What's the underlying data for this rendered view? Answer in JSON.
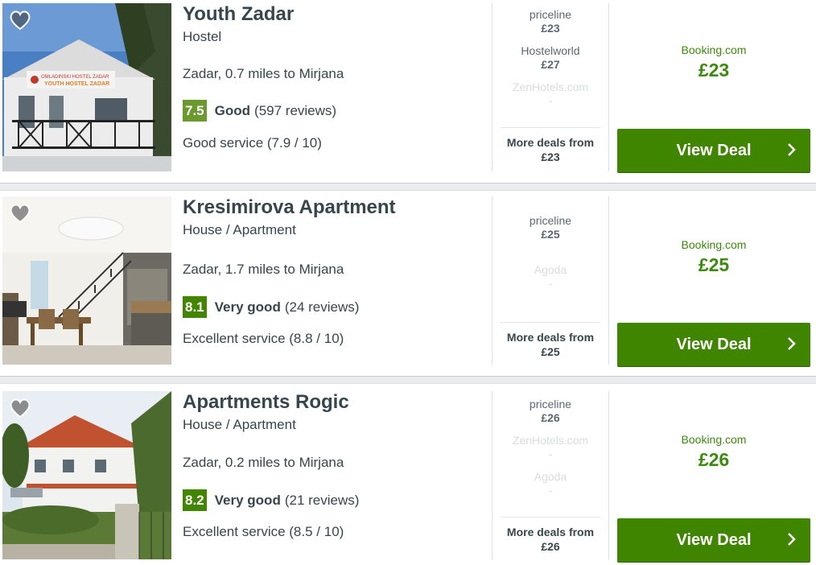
{
  "hotels": [
    {
      "name": "Youth Zadar",
      "type": "Hostel",
      "location": "Zadar, 0.7 miles to Mirjana",
      "score": "7.5",
      "rating_label": "Good",
      "reviews": "(597 reviews)",
      "service": "Good service (7.9 / 10)",
      "sign_text": "OMLADINSKI HOSTEL ZADAR YOUTH HOSTEL ZADAR",
      "deals": [
        {
          "provider": "priceline",
          "price": "£23",
          "dim": false
        },
        {
          "provider": "Hostelworld",
          "price": "£27",
          "dim": false
        },
        {
          "provider": "ZenHotels.com",
          "price": "-",
          "dim": true
        }
      ],
      "more_label": "More deals from",
      "more_price": "£23",
      "best_provider": "Booking.com",
      "best_price": "£23",
      "cta": "View Deal"
    },
    {
      "name": "Kresimirova Apartment",
      "type": "House / Apartment",
      "location": "Zadar, 1.7 miles to Mirjana",
      "score": "8.1",
      "rating_label": "Very good",
      "reviews": "(24 reviews)",
      "service": "Excellent service (8.8 / 10)",
      "deals": [
        {
          "provider": "priceline",
          "price": "£25",
          "dim": false
        },
        {
          "provider": "Agoda",
          "price": "-",
          "dim": true
        }
      ],
      "more_label": "More deals from",
      "more_price": "£25",
      "best_provider": "Booking.com",
      "best_price": "£25",
      "cta": "View Deal"
    },
    {
      "name": "Apartments Rogic",
      "type": "House / Apartment",
      "location": "Zadar, 0.2 miles to Mirjana",
      "score": "8.2",
      "rating_label": "Very good",
      "reviews": "(21 reviews)",
      "service": "Excellent service (8.5 / 10)",
      "deals": [
        {
          "provider": "priceline",
          "price": "£26",
          "dim": false
        },
        {
          "provider": "ZenHotels.com",
          "price": "-",
          "dim": true
        },
        {
          "provider": "Agoda",
          "price": "-",
          "dim": true
        }
      ],
      "more_label": "More deals from",
      "more_price": "£26",
      "best_provider": "Booking.com",
      "best_price": "£26",
      "cta": "View Deal"
    }
  ],
  "colors": {
    "cta": "#3f8500",
    "price_green": "#3c8a0e",
    "score_good": "#6a9a2e",
    "score_very_good": "#428500"
  },
  "icons": {
    "favorite": "heart-icon",
    "cta_arrow": "chevron-right-icon"
  }
}
